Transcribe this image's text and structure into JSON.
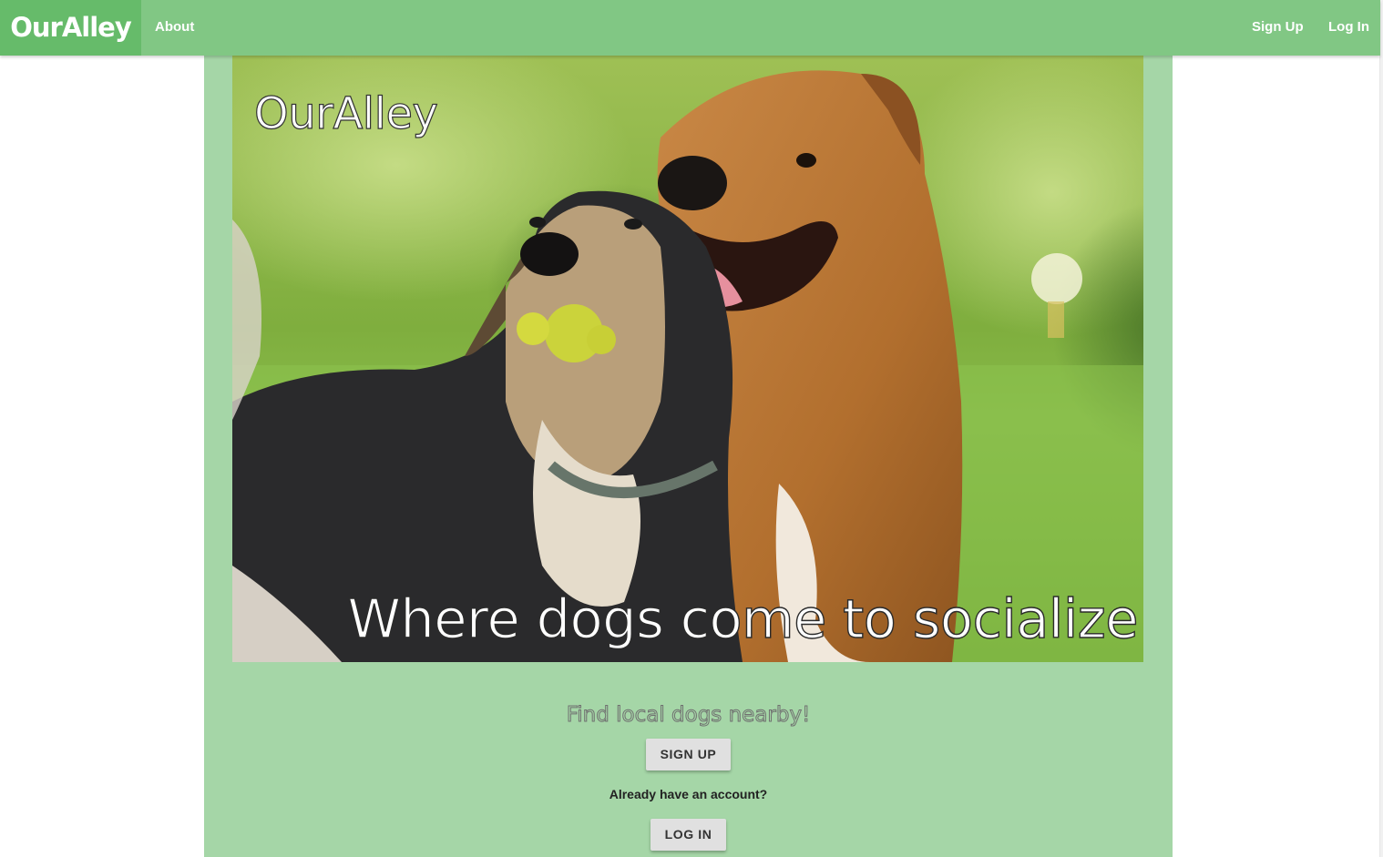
{
  "navbar": {
    "brand": "OurAlley",
    "about_label": "About",
    "signup_label": "Sign Up",
    "login_label": "Log In"
  },
  "hero": {
    "title": "OurAlley",
    "tagline": "Where dogs come to socialize"
  },
  "cta": {
    "find_text": "Find local dogs nearby!",
    "signup_button": "SIGN UP",
    "account_prompt": "Already have an account?",
    "login_button": "LOG IN"
  },
  "colors": {
    "navbar": "#81c784",
    "brand_bg": "#66bb6a",
    "content_bg": "#a5d6a7",
    "button_bg": "#e0e0e0"
  }
}
